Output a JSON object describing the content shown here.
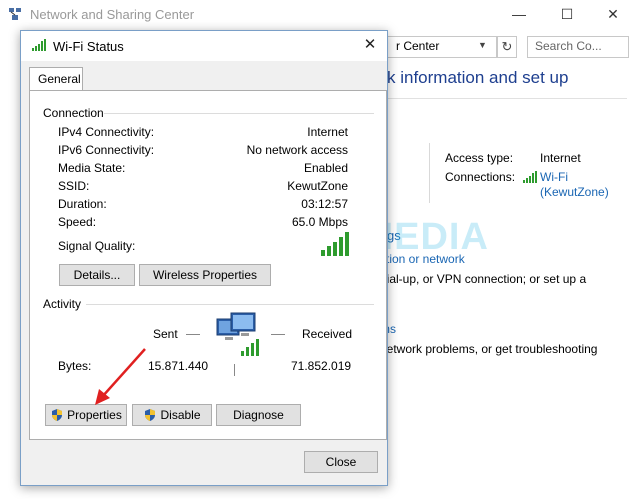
{
  "background_window": {
    "title": "Network and Sharing Center",
    "address_text": "r Center",
    "search_placeholder": "Search Co...",
    "heading": "k information and set up",
    "access_type_label": "Access type:",
    "access_type_value": "Internet",
    "connections_label": "Connections:",
    "connection_link_line1": "Wi-Fi",
    "connection_link_line2": "(KewutZone)",
    "change_settings_partial": "gs",
    "setup_link_partial": "ction or network",
    "setup_desc_line1": "dial-up, or VPN connection; or set up a",
    "setup_desc_line2": "t.",
    "troubleshoot_link_partial": "ms",
    "troubleshoot_desc": "network problems, or get troubleshooting"
  },
  "watermark": "NESABAMEDIA",
  "dialog": {
    "title": "Wi-Fi Status",
    "tab_label": "General",
    "connection_section": "Connection",
    "rows": [
      {
        "label": "IPv4 Connectivity:",
        "value": "Internet"
      },
      {
        "label": "IPv6 Connectivity:",
        "value": "No network access"
      },
      {
        "label": "Media State:",
        "value": "Enabled"
      },
      {
        "label": "SSID:",
        "value": "KewutZone"
      },
      {
        "label": "Duration:",
        "value": "03:12:57"
      },
      {
        "label": "Speed:",
        "value": "65.0 Mbps"
      }
    ],
    "signal_quality_label": "Signal Quality:",
    "details_button": "Details...",
    "wireless_properties_button": "Wireless Properties",
    "activity_section": "Activity",
    "sent_label": "Sent",
    "received_label": "Received",
    "bytes_label": "Bytes:",
    "bytes_sent": "15.871.440",
    "bytes_received": "71.852.019",
    "properties_button": "Properties",
    "disable_button": "Disable",
    "diagnose_button": "Diagnose",
    "close_button": "Close"
  },
  "colors": {
    "link": "#1a66b3",
    "signal_green": "#2e9b2e",
    "annotation_arrow": "#e02020"
  }
}
